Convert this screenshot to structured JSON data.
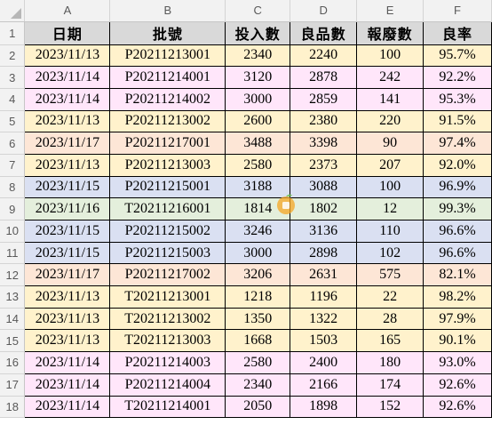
{
  "columns": [
    "A",
    "B",
    "C",
    "D",
    "E",
    "F"
  ],
  "headers": [
    "日期",
    "批號",
    "投入數",
    "良品數",
    "報廢數",
    "良率"
  ],
  "colors": {
    "yellow": "#fff2cc",
    "pink": "#ffe6fa",
    "peach": "#fde6d6",
    "blue": "#dae0f2",
    "green": "#e4efdc",
    "title_bg": "#d9d9d9"
  },
  "rows": [
    {
      "num": "2",
      "color": "yellow",
      "cells": [
        "2023/11/13",
        "P20211213001",
        "2340",
        "2240",
        "100",
        "95.7%"
      ]
    },
    {
      "num": "3",
      "color": "pink",
      "cells": [
        "2023/11/14",
        "P20211214001",
        "3120",
        "2878",
        "242",
        "92.2%"
      ]
    },
    {
      "num": "4",
      "color": "pink",
      "cells": [
        "2023/11/14",
        "P20211214002",
        "3000",
        "2859",
        "141",
        "95.3%"
      ]
    },
    {
      "num": "5",
      "color": "yellow",
      "cells": [
        "2023/11/13",
        "P20211213002",
        "2600",
        "2380",
        "220",
        "91.5%"
      ]
    },
    {
      "num": "6",
      "color": "peach",
      "cells": [
        "2023/11/17",
        "P20211217001",
        "3488",
        "3398",
        "90",
        "97.4%"
      ]
    },
    {
      "num": "7",
      "color": "yellow",
      "cells": [
        "2023/11/13",
        "P20211213003",
        "2580",
        "2373",
        "207",
        "92.0%"
      ]
    },
    {
      "num": "8",
      "color": "blue",
      "cells": [
        "2023/11/15",
        "P20211215001",
        "3188",
        "3088",
        "100",
        "96.9%"
      ]
    },
    {
      "num": "9",
      "color": "green",
      "cells": [
        "2023/11/16",
        "T20211216001",
        "1814",
        "1802",
        "12",
        "99.3%"
      ]
    },
    {
      "num": "10",
      "color": "blue",
      "cells": [
        "2023/11/15",
        "P20211215002",
        "3246",
        "3136",
        "110",
        "96.6%"
      ]
    },
    {
      "num": "11",
      "color": "blue",
      "cells": [
        "2023/11/15",
        "P20211215003",
        "3000",
        "2898",
        "102",
        "96.6%"
      ]
    },
    {
      "num": "12",
      "color": "peach",
      "cells": [
        "2023/11/17",
        "P20211217002",
        "3206",
        "2631",
        "575",
        "82.1%"
      ]
    },
    {
      "num": "13",
      "color": "yellow",
      "cells": [
        "2023/11/13",
        "T20211213001",
        "1218",
        "1196",
        "22",
        "98.2%"
      ]
    },
    {
      "num": "14",
      "color": "yellow",
      "cells": [
        "2023/11/13",
        "T20211213002",
        "1350",
        "1322",
        "28",
        "97.9%"
      ]
    },
    {
      "num": "15",
      "color": "yellow",
      "cells": [
        "2023/11/13",
        "T20211213003",
        "1668",
        "1503",
        "165",
        "90.1%"
      ]
    },
    {
      "num": "16",
      "color": "pink",
      "cells": [
        "2023/11/14",
        "P20211214003",
        "2580",
        "2400",
        "180",
        "93.0%"
      ]
    },
    {
      "num": "17",
      "color": "pink",
      "cells": [
        "2023/11/14",
        "P20211214004",
        "2340",
        "2166",
        "174",
        "92.6%"
      ]
    },
    {
      "num": "18",
      "color": "pink",
      "cells": [
        "2023/11/14",
        "T20211214001",
        "2050",
        "1898",
        "152",
        "92.6%"
      ]
    }
  ],
  "title_row_num": "1",
  "watermark_icon": "orange-fruit-icon"
}
